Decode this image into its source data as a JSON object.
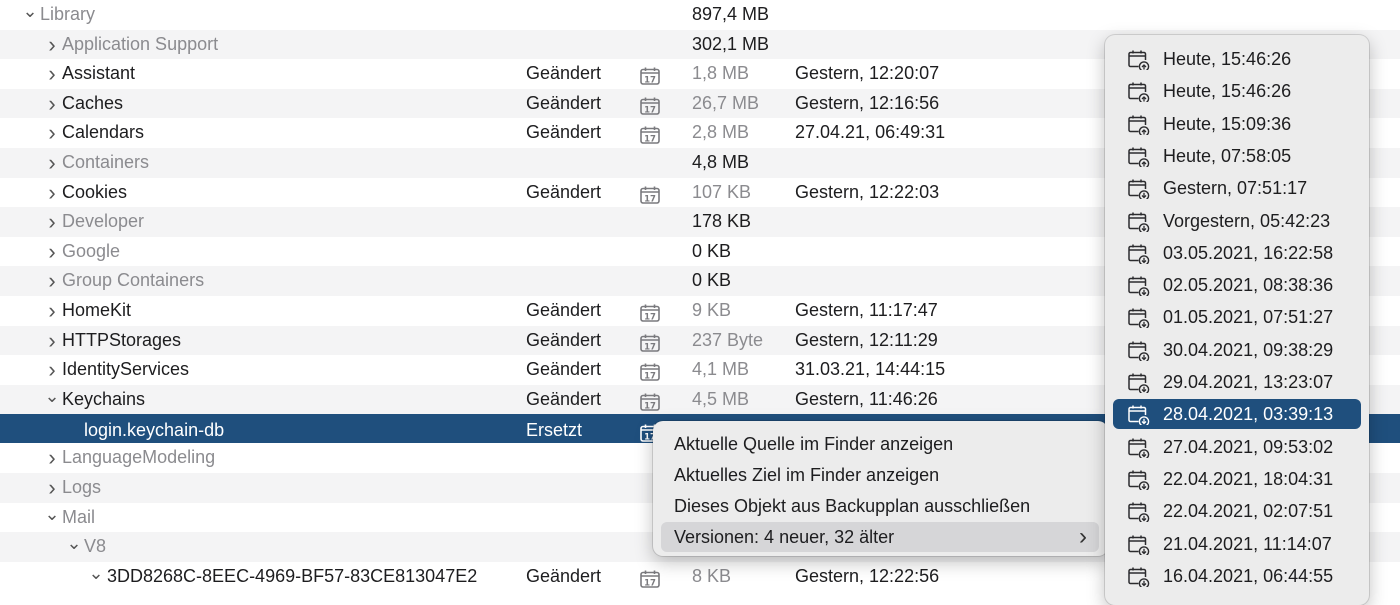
{
  "rows": [
    {
      "level": 0,
      "chevron": "down",
      "name": "Library",
      "dim": true,
      "status": "",
      "size": "897,4 MB",
      "sizeDim": false,
      "date": "",
      "cal": false,
      "alt": false
    },
    {
      "level": 1,
      "chevron": "right",
      "name": "Application Support",
      "dim": true,
      "status": "",
      "size": "302,1 MB",
      "sizeDim": false,
      "date": "",
      "cal": false,
      "alt": true
    },
    {
      "level": 1,
      "chevron": "right",
      "name": "Assistant",
      "dim": false,
      "status": "Geändert",
      "size": "1,8 MB",
      "sizeDim": true,
      "date": "Gestern, 12:20:07",
      "cal": true,
      "alt": false
    },
    {
      "level": 1,
      "chevron": "right",
      "name": "Caches",
      "dim": false,
      "status": "Geändert",
      "size": "26,7 MB",
      "sizeDim": true,
      "date": "Gestern, 12:16:56",
      "cal": true,
      "alt": true
    },
    {
      "level": 1,
      "chevron": "right",
      "name": "Calendars",
      "dim": false,
      "status": "Geändert",
      "size": "2,8 MB",
      "sizeDim": true,
      "date": "27.04.21, 06:49:31",
      "cal": true,
      "alt": false
    },
    {
      "level": 1,
      "chevron": "right",
      "name": "Containers",
      "dim": true,
      "status": "",
      "size": "4,8 MB",
      "sizeDim": false,
      "date": "",
      "cal": false,
      "alt": true
    },
    {
      "level": 1,
      "chevron": "right",
      "name": "Cookies",
      "dim": false,
      "status": "Geändert",
      "size": "107 KB",
      "sizeDim": true,
      "date": "Gestern, 12:22:03",
      "cal": true,
      "alt": false
    },
    {
      "level": 1,
      "chevron": "right",
      "name": "Developer",
      "dim": true,
      "status": "",
      "size": "178 KB",
      "sizeDim": false,
      "date": "",
      "cal": false,
      "alt": true
    },
    {
      "level": 1,
      "chevron": "right",
      "name": "Google",
      "dim": true,
      "status": "",
      "size": "0 KB",
      "sizeDim": false,
      "date": "",
      "cal": false,
      "alt": false
    },
    {
      "level": 1,
      "chevron": "right",
      "name": "Group Containers",
      "dim": true,
      "status": "",
      "size": "0 KB",
      "sizeDim": false,
      "date": "",
      "cal": false,
      "alt": true
    },
    {
      "level": 1,
      "chevron": "right",
      "name": "HomeKit",
      "dim": false,
      "status": "Geändert",
      "size": "9 KB",
      "sizeDim": true,
      "date": "Gestern, 11:17:47",
      "cal": true,
      "alt": false
    },
    {
      "level": 1,
      "chevron": "right",
      "name": "HTTPStorages",
      "dim": false,
      "status": "Geändert",
      "size": "237 Byte",
      "sizeDim": true,
      "date": "Gestern, 12:11:29",
      "cal": true,
      "alt": true
    },
    {
      "level": 1,
      "chevron": "right",
      "name": "IdentityServices",
      "dim": false,
      "status": "Geändert",
      "size": "4,1 MB",
      "sizeDim": true,
      "date": "31.03.21, 14:44:15",
      "cal": true,
      "alt": false
    },
    {
      "level": 1,
      "chevron": "down",
      "name": "Keychains",
      "dim": false,
      "status": "Geändert",
      "size": "4,5 MB",
      "sizeDim": true,
      "date": "Gestern, 11:46:26",
      "cal": true,
      "alt": true
    },
    {
      "level": 2,
      "chevron": "",
      "name": "login.keychain-db",
      "dim": false,
      "status": "Ersetzt",
      "size": "",
      "sizeDim": false,
      "date": "",
      "cal": true,
      "alt": false,
      "selected": true
    },
    {
      "level": 1,
      "chevron": "right",
      "name": "LanguageModeling",
      "dim": true,
      "status": "",
      "size": "",
      "sizeDim": false,
      "date": "",
      "cal": false,
      "alt": false
    },
    {
      "level": 1,
      "chevron": "right",
      "name": "Logs",
      "dim": true,
      "status": "",
      "size": "",
      "sizeDim": false,
      "date": "",
      "cal": false,
      "alt": true
    },
    {
      "level": 1,
      "chevron": "down",
      "name": "Mail",
      "dim": true,
      "status": "",
      "size": "",
      "sizeDim": false,
      "date": "",
      "cal": false,
      "alt": false
    },
    {
      "level": 2,
      "chevron": "down",
      "name": "V8",
      "dim": true,
      "status": "",
      "size": "",
      "sizeDim": false,
      "date": "",
      "cal": false,
      "alt": true
    },
    {
      "level": 3,
      "chevron": "down",
      "name": "3DD8268C-8EEC-4969-BF57-83CE813047E2",
      "dim": false,
      "status": "Geändert",
      "size": "8 KB",
      "sizeDim": true,
      "date": "Gestern, 12:22:56",
      "cal": true,
      "alt": false
    }
  ],
  "context_menu": {
    "items": [
      {
        "label": "Aktuelle Quelle im Finder anzeigen"
      },
      {
        "label": "Aktuelles Ziel im Finder anzeigen"
      },
      {
        "label": "Dieses Objekt aus Backupplan ausschließen"
      },
      {
        "label": "Versionen: 4 neuer, 32 älter",
        "submenu": true,
        "highlighted": true
      }
    ]
  },
  "versions_menu": {
    "items": [
      {
        "label": "Heute, 15:46:26",
        "kind": "upload"
      },
      {
        "label": "Heute, 15:46:26",
        "kind": "upload"
      },
      {
        "label": "Heute, 15:09:36",
        "kind": "upload"
      },
      {
        "label": "Heute, 07:58:05",
        "kind": "upload"
      },
      {
        "label": "Gestern, 07:51:17",
        "kind": "download"
      },
      {
        "label": "Vorgestern, 05:42:23",
        "kind": "download"
      },
      {
        "label": "03.05.2021, 16:22:58",
        "kind": "download"
      },
      {
        "label": "02.05.2021, 08:38:36",
        "kind": "download"
      },
      {
        "label": "01.05.2021, 07:51:27",
        "kind": "download"
      },
      {
        "label": "30.04.2021, 09:38:29",
        "kind": "download"
      },
      {
        "label": "29.04.2021, 13:23:07",
        "kind": "download"
      },
      {
        "label": "28.04.2021, 03:39:13",
        "kind": "download",
        "selected": true
      },
      {
        "label": "27.04.2021, 09:53:02",
        "kind": "download"
      },
      {
        "label": "22.04.2021, 18:04:31",
        "kind": "download"
      },
      {
        "label": "22.04.2021, 02:07:51",
        "kind": "download"
      },
      {
        "label": "21.04.2021, 11:14:07",
        "kind": "download"
      },
      {
        "label": "16.04.2021, 06:44:55",
        "kind": "download"
      }
    ]
  },
  "icons": {
    "calendar": "calendar-17-icon",
    "chevron_right": "chevron-right-icon",
    "chevron_down": "chevron-down-icon",
    "version": "calendar-clock-icon"
  },
  "colors": {
    "selection": "#1f4f7d",
    "alt_row": "#f4f4f5",
    "menu_bg": "#ececec",
    "dim_text": "#8b8b8f"
  }
}
